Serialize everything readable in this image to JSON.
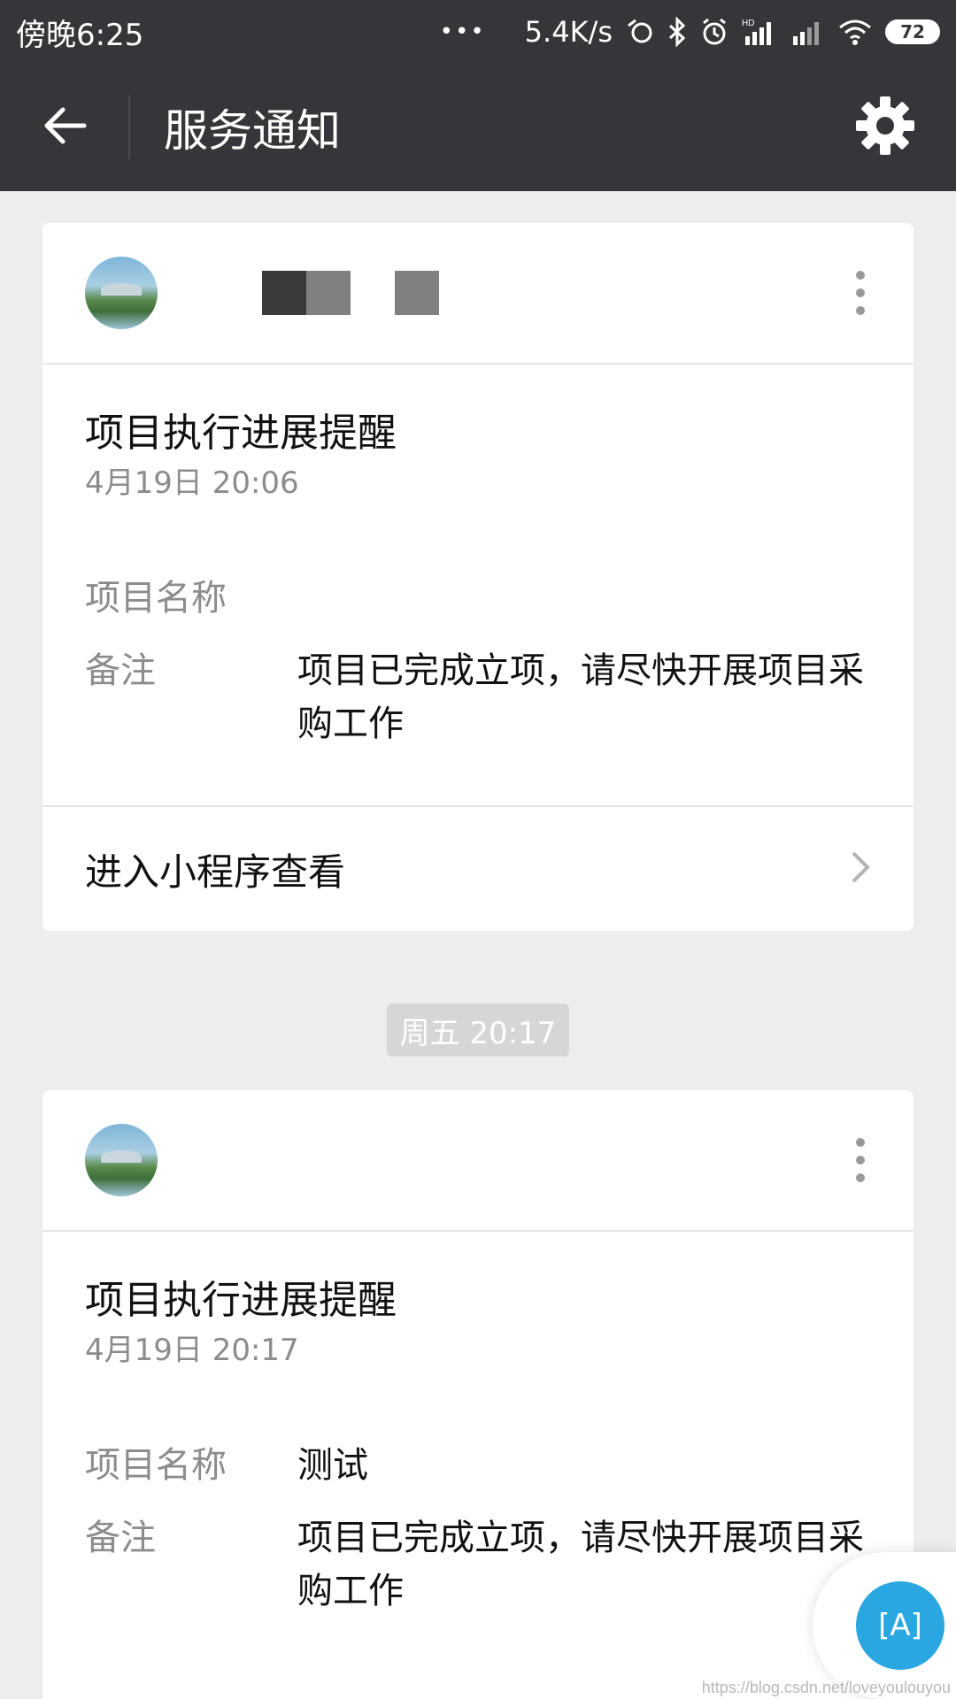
{
  "status_bar": {
    "time": "傍晚6:25",
    "dots": "•••",
    "net_speed": "5.4K/s",
    "battery": "72",
    "icons": [
      "sync-icon",
      "bluetooth-icon",
      "alarm-icon",
      "hd-signal-icon",
      "signal-icon",
      "wifi-icon",
      "battery-icon"
    ]
  },
  "title_bar": {
    "title": "服务通知",
    "back_icon": "back-arrow-icon",
    "settings_icon": "gear-icon"
  },
  "cards": [
    {
      "title": "项目执行进展提醒",
      "time": "4月19日  20:06",
      "fields": [
        {
          "label": "项目名称",
          "value": ""
        },
        {
          "label": "备注",
          "value": "项目已完成立项，请尽快开展项目采购工作"
        }
      ],
      "footer": "进入小程序查看"
    },
    {
      "title": "项目执行进展提醒",
      "time": "4月19日  20:17",
      "fields": [
        {
          "label": "项目名称",
          "value": "测试"
        },
        {
          "label": "备注",
          "value": "项目已完成立项，请尽快开展项目采购工作"
        }
      ]
    }
  ],
  "time_chip": "周五 20:17",
  "floating_button": "[A]",
  "watermark": "https://blog.csdn.net/loveyoulouyou",
  "colors": {
    "bar_bg": "#35363a",
    "page_bg": "#ededed",
    "accent": "#2aa7e0",
    "muted_text": "#8c8c8c"
  }
}
